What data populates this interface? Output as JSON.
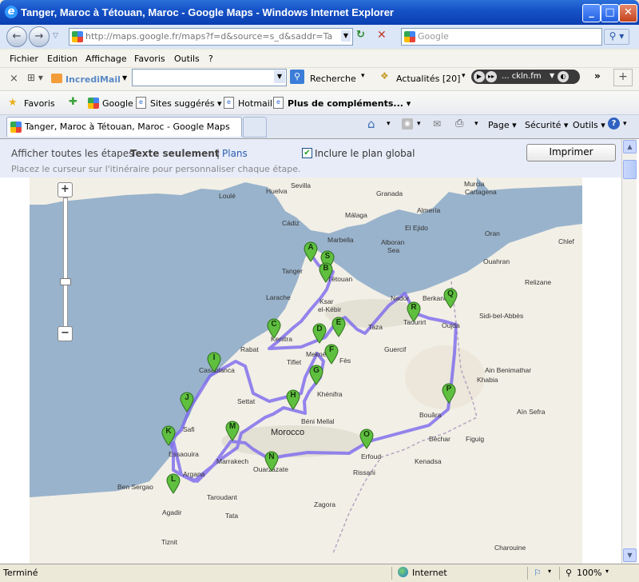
{
  "window": {
    "title": "Tanger, Maroc à Tétouan, Maroc - Google Maps - Windows Internet Explorer"
  },
  "address_bar": {
    "url": "http://maps.google.fr/maps?f=d&source=s_d&saddr=Tanger,+T..."
  },
  "search_box": {
    "placeholder": "Google"
  },
  "menu": {
    "items": [
      "Fichier",
      "Edition",
      "Affichage",
      "Favoris",
      "Outils",
      "?"
    ]
  },
  "incredimail_bar": {
    "close": "×",
    "brand": "IncrediMail",
    "search_label": "Recherche",
    "news_label": "Actualités",
    "news_count": "[20]",
    "radio_label": "... ckln.fm",
    "more": "»",
    "add": "+"
  },
  "favorites_bar": {
    "favoris": "Favoris",
    "items": [
      "Google",
      "Sites suggérés",
      "Hotmail",
      "Plus de compléments..."
    ]
  },
  "tab": {
    "title": "Tanger, Maroc à Tétouan, Maroc - Google Maps"
  },
  "command_bar": {
    "items": [
      "Page",
      "Sécurité",
      "Outils"
    ]
  },
  "print_view": {
    "show_all": "Afficher toutes les étapes",
    "text_only": "Texte seulement",
    "separator": "|",
    "plans": "Plans",
    "include_label": "Inclure le plan global",
    "include_checked": true,
    "hint": "Placez le curseur sur l'itinéraire pour personnaliser chaque étape.",
    "print_button": "Imprimer"
  },
  "map": {
    "places": [
      "Loulé",
      "Huelva",
      "Sevilla",
      "Granada",
      "Murcia",
      "Cartagena",
      "Almería",
      "Málaga",
      "Cádiz",
      "El Ejido",
      "Marbella",
      "Alboran",
      "Sea",
      "Tanger",
      "Tétouan",
      "Larache",
      "Ksar",
      "el-Kébir",
      "Nador",
      "Berkane",
      "Taza",
      "Taourirt",
      "Oujda",
      "Oran",
      "Chlef",
      "Ouahran",
      "Relizane",
      "Sidi-bel-Abbès",
      "Guercif",
      "Kenitra",
      "Rabat",
      "Tiflet",
      "Meknès",
      "Fès",
      "Casablanca",
      "Settat",
      "Khénifra",
      "Ain Benimathar",
      "Aïn Sefra",
      "Khabia",
      "Béni Mellal",
      "Bouâra",
      "Safi",
      "Morocco",
      "Béchar",
      "Figuig",
      "Essaouira",
      "Marrakech",
      "Erfoud",
      "Kenadsa",
      "Ouarzazate",
      "Rissani",
      "Argana",
      "Ben Sergao",
      "Agadir",
      "Taroudant",
      "Tata",
      "Zagora",
      "Tiznit",
      "Charouine"
    ],
    "markers": [
      "A",
      "S",
      "B",
      "R",
      "Q",
      "C",
      "D",
      "E",
      "F",
      "I",
      "G",
      "J",
      "H",
      "P",
      "M",
      "K",
      "O",
      "N",
      "L"
    ],
    "zoom_in": "+",
    "zoom_out": "−"
  },
  "status_bar": {
    "left": "Terminé",
    "zone": "Internet",
    "zoom": "100%"
  },
  "colors": {
    "title_bar": "#1653c8",
    "route": "#7b68ee",
    "marker": "#5fbf3f",
    "water": "#99b3cc",
    "land": "#f2efe6"
  }
}
